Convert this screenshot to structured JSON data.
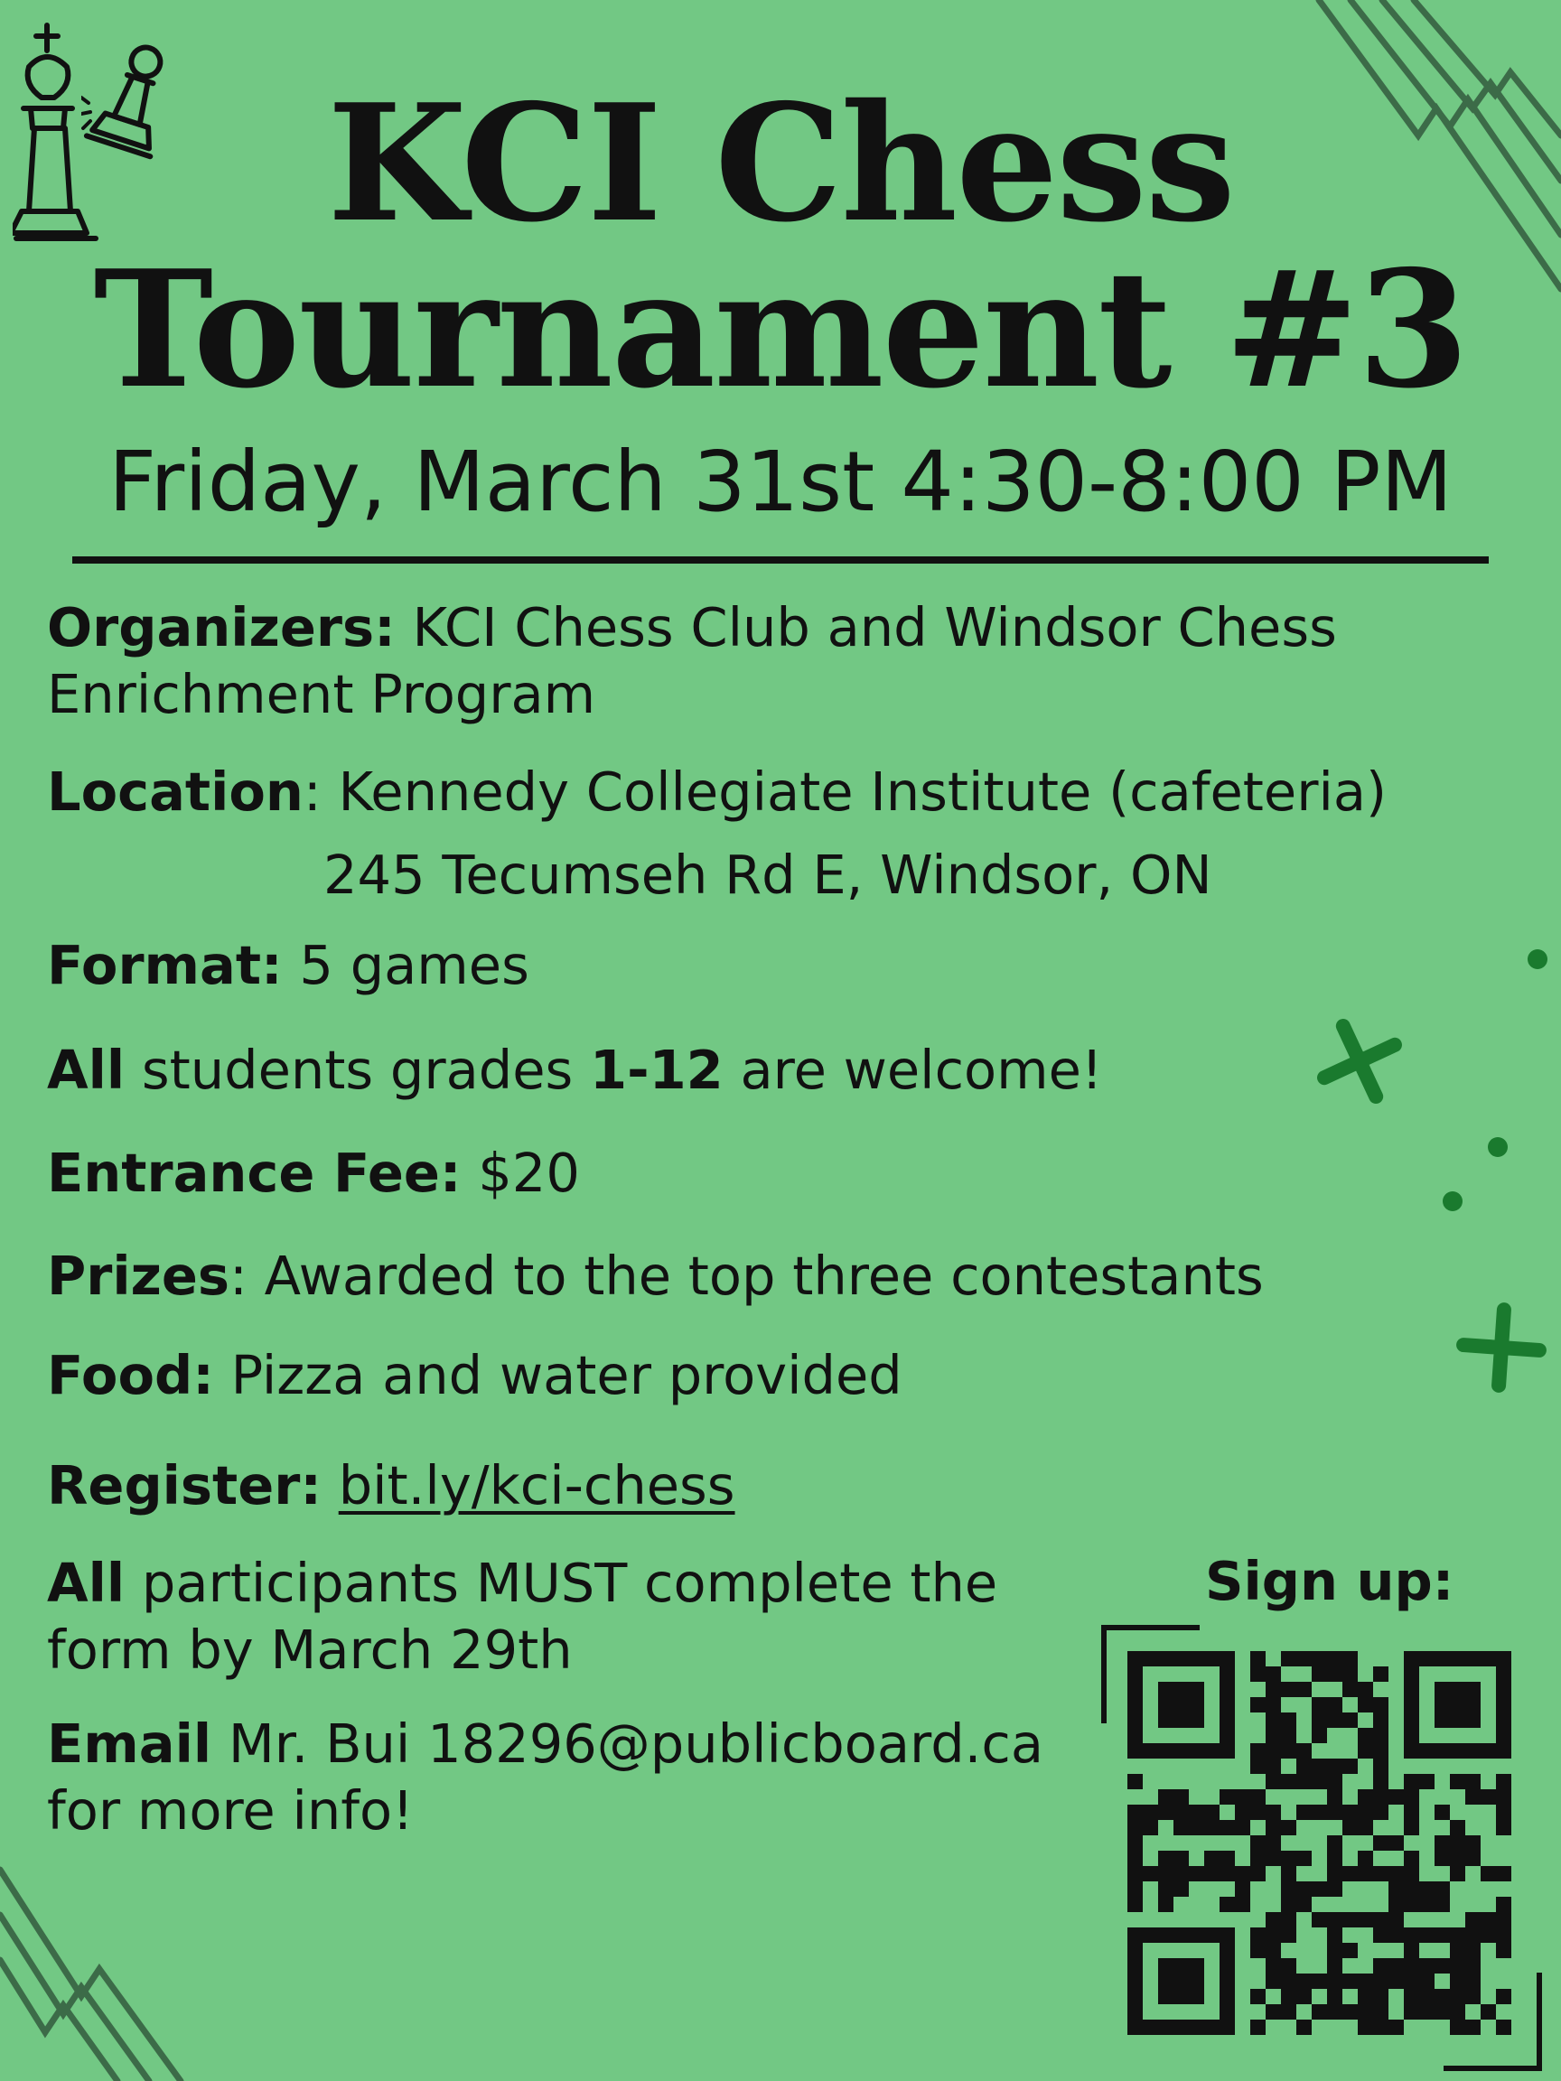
{
  "title": {
    "line1": "KCI Chess",
    "line2": "Tournament #3"
  },
  "subtitle": "Friday, March 31st 4:30-8:00 PM",
  "details": {
    "organizers": {
      "label": "Organizers:",
      "text": "KCI Chess Club and Windsor Chess",
      "text2": "Enrichment Program"
    },
    "location": {
      "label": "Location",
      "text": ": Kennedy Collegiate Institute (cafeteria)",
      "address": "245 Tecumseh Rd E, Windsor, ON"
    },
    "format": {
      "label": "Format:",
      "text": "5 games"
    },
    "welcome": {
      "bold1": "All",
      "text1": "students grades",
      "bold2": "1-12",
      "text2": "are welcome!"
    },
    "fee": {
      "label": "Entrance Fee:",
      "text": "$20"
    },
    "prizes": {
      "label": "Prizes",
      "text": ": Awarded to the top three contestants"
    },
    "food": {
      "label": "Food:",
      "text": "Pizza and water provided"
    },
    "register": {
      "label": "Register:",
      "link": "bit.ly/kci-chess"
    },
    "deadline": {
      "bold": "All",
      "text": "participants MUST complete the",
      "text2": "form by March 29th"
    },
    "email": {
      "bold": "Email",
      "text": "Mr. Bui 18296@publicboard.ca",
      "text2": "for more info!"
    }
  },
  "signup": {
    "label": "Sign up:"
  },
  "icons": [
    "chess-king-icon",
    "chess-pawn-icon",
    "qr-code",
    "plus-icon",
    "dot-icon"
  ],
  "colors": {
    "background": "#72c884",
    "accent": "#1a7a2e",
    "text": "#111111"
  }
}
